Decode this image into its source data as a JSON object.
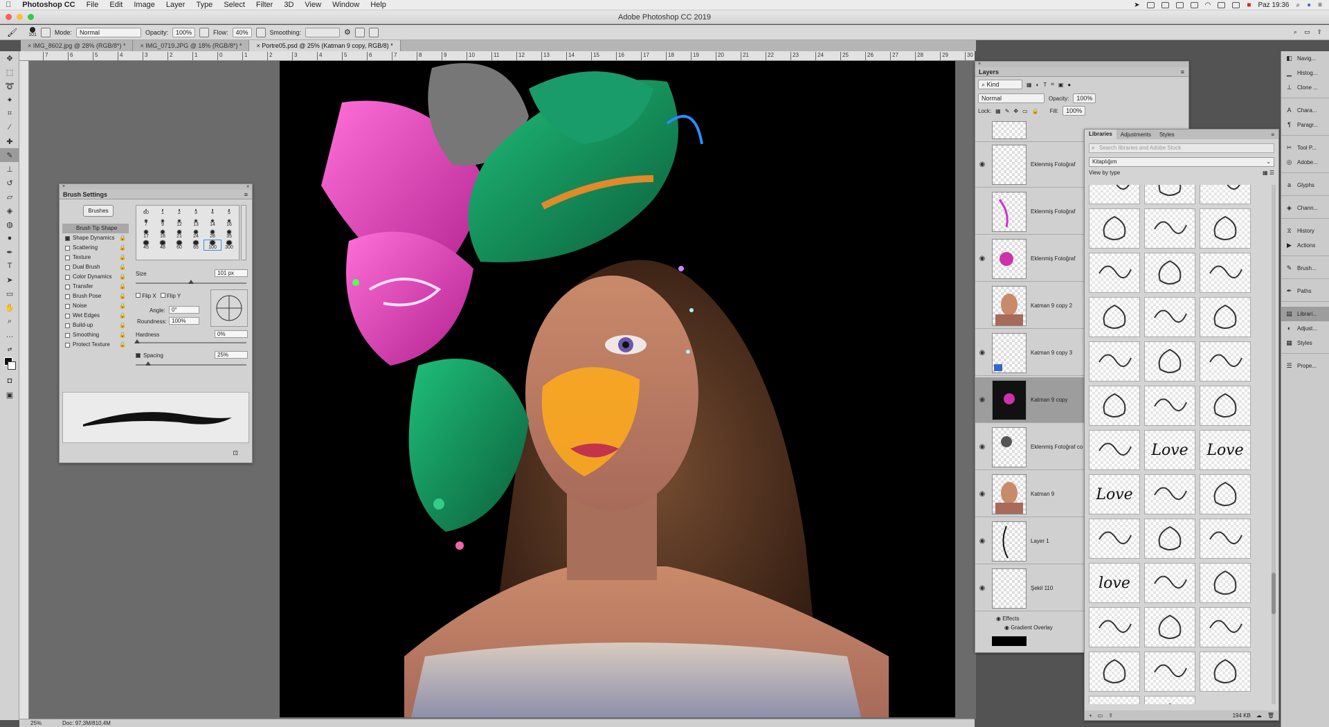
{
  "menubar": {
    "apple": "",
    "app_name": "Photoshop CC",
    "items": [
      "File",
      "Edit",
      "Image",
      "Layer",
      "Type",
      "Select",
      "Filter",
      "3D",
      "View",
      "Window",
      "Help"
    ],
    "clock": "Paz 19:36"
  },
  "window": {
    "title": "Adobe Photoshop CC 2019"
  },
  "options_bar": {
    "brush_size": "101",
    "mode_label": "Mode:",
    "mode_value": "Normal",
    "opacity_label": "Opacity:",
    "opacity_value": "100%",
    "flow_label": "Flow:",
    "flow_value": "40%",
    "smoothing_label": "Smoothing:",
    "smoothing_value": ""
  },
  "tabs": [
    {
      "label": "IMG_8602.jpg @ 28% (RGB/8*) *"
    },
    {
      "label": "IMG_0719.JPG @ 18% (RGB/8*) *"
    },
    {
      "label": "Portre05.psd @ 25% (Katman 9 copy, RGB/8) *"
    }
  ],
  "ruler": {
    "ticks": [
      "7",
      "6",
      "5",
      "4",
      "3",
      "2",
      "1",
      "0",
      "1",
      "2",
      "3",
      "4",
      "5",
      "6",
      "7",
      "8",
      "9",
      "10",
      "11",
      "12",
      "13",
      "14",
      "15",
      "16",
      "17",
      "18",
      "19",
      "20",
      "21",
      "22",
      "23",
      "24",
      "25",
      "26",
      "27",
      "28",
      "29",
      "30"
    ]
  },
  "status": {
    "zoom": "25%",
    "doc": "Doc: 97,3M/810,4M"
  },
  "brush_settings": {
    "title": "Brush Settings",
    "brushes_button": "Brushes",
    "options": [
      {
        "label": "Brush Tip Shape",
        "checked": null
      },
      {
        "label": "Shape Dynamics",
        "checked": true
      },
      {
        "label": "Scattering",
        "checked": false
      },
      {
        "label": "Texture",
        "checked": false
      },
      {
        "label": "Dual Brush",
        "checked": false
      },
      {
        "label": "Color Dynamics",
        "checked": false
      },
      {
        "label": "Transfer",
        "checked": false
      },
      {
        "label": "Brush Pose",
        "checked": false
      },
      {
        "label": "Noise",
        "checked": false
      },
      {
        "label": "Wet Edges",
        "checked": false
      },
      {
        "label": "Build-up",
        "checked": false
      },
      {
        "label": "Smoothing",
        "checked": false
      },
      {
        "label": "Protect Texture",
        "checked": false
      }
    ],
    "tip_rows": [
      [
        "60",
        "1",
        "2",
        "3",
        "4",
        "5"
      ],
      [
        "7",
        "9",
        "12",
        "13",
        "14",
        "16"
      ],
      [
        "17",
        "18",
        "21",
        "24",
        "28",
        "35"
      ],
      [
        "45",
        "48",
        "60",
        "65",
        "100",
        "300"
      ]
    ],
    "size_label": "Size",
    "size_value": "101 px",
    "flip_x": "Flip X",
    "flip_y": "Flip Y",
    "angle_label": "Angle:",
    "angle_value": "0°",
    "roundness_label": "Roundness:",
    "roundness_value": "100%",
    "hardness_label": "Hardness",
    "hardness_value": "0%",
    "spacing_label": "Spacing",
    "spacing_value": "25%"
  },
  "layers_panel": {
    "title": "Layers",
    "filter_value": "Kind",
    "blend_value": "Normal",
    "opacity_label": "Opacity:",
    "opacity_value": "100%",
    "lock_label": "Lock:",
    "fill_label": "Fill:",
    "fill_value": "100%",
    "layers": [
      {
        "name": "Eklenmiş Fotoğraf",
        "visible": true,
        "selected": false
      },
      {
        "name": "Eklenmiş Fotoğraf",
        "visible": false,
        "selected": false
      },
      {
        "name": "Eklenmiş Fotoğraf",
        "visible": true,
        "selected": false
      },
      {
        "name": "Katman 9 copy 2",
        "visible": false,
        "selected": false
      },
      {
        "name": "Katman 9 copy 3",
        "visible": true,
        "selected": false
      },
      {
        "name": "Katman 9 copy",
        "visible": true,
        "selected": true
      },
      {
        "name": "Eklenmiş Fotoğraf co",
        "visible": true,
        "selected": false
      },
      {
        "name": "Katman 9",
        "visible": true,
        "selected": false
      },
      {
        "name": "Layer 1",
        "visible": true,
        "selected": false
      },
      {
        "name": "Şekil 110",
        "visible": true,
        "selected": false
      }
    ],
    "effects_label": "Effects",
    "gradient_overlay_label": "Gradient Overlay"
  },
  "libraries_panel": {
    "tabs": [
      "Libraries",
      "Adjustments",
      "Styles"
    ],
    "search_placeholder": "Search libraries and Adobe Stock",
    "library_name": "Kitaplığım",
    "view_by": "View by type",
    "size_text": "194 KB",
    "tile_texts": [
      "",
      "",
      "",
      "",
      "",
      "",
      "",
      "",
      "",
      "",
      "",
      "",
      "",
      "",
      "",
      "",
      "",
      "",
      "",
      "Love",
      "Love",
      "Love",
      "",
      "",
      "",
      "",
      "",
      "love",
      "",
      "",
      "",
      "",
      "",
      "",
      "",
      "",
      "",
      ""
    ]
  },
  "dock": {
    "group1": [
      "Navig...",
      "Histog...",
      "Clone ..."
    ],
    "group2": [
      "Chara...",
      "Paragr..."
    ],
    "group3": [
      "Tool P...",
      "Adobe..."
    ],
    "group4": [
      "Glyphs"
    ],
    "group5": [
      "Chann..."
    ],
    "group6": [
      "History",
      "Actions"
    ],
    "group7": [
      "Brush..."
    ],
    "group8": [
      "Paths"
    ],
    "group9": [
      "Librari...",
      "Adjust...",
      "Styles"
    ],
    "group10": [
      "Prope..."
    ]
  }
}
